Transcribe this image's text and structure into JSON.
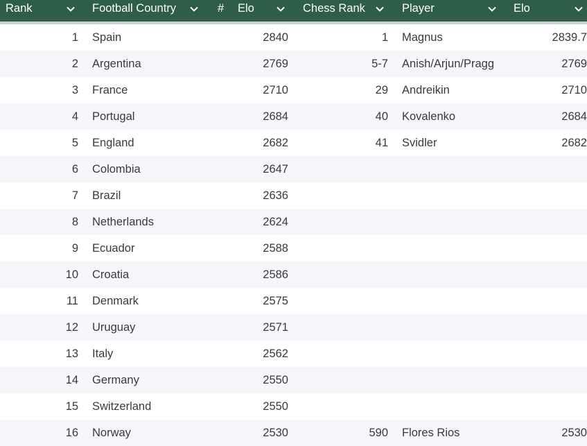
{
  "header": {
    "rank": "Rank",
    "football_country": "Football Country",
    "hash": "#",
    "elo": "Elo",
    "chess_rank": "Chess Rank",
    "player": "Player",
    "player_elo": "Elo"
  },
  "icons": {
    "sort": "chevron-down-icon"
  },
  "colors": {
    "header_bg": "#2e5e4a",
    "header_text": "#ffffff",
    "row_alt": "#f5f7fa"
  },
  "rows": [
    {
      "rank": "1",
      "country": "Spain",
      "elo": "2840",
      "chess_rank": "1",
      "player": "Magnus",
      "player_elo": "2839.7"
    },
    {
      "rank": "2",
      "country": "Argentina",
      "elo": "2769",
      "chess_rank": "5-7",
      "player": "Anish/Arjun/Pragg",
      "player_elo": "2769"
    },
    {
      "rank": "3",
      "country": "France",
      "elo": "2710",
      "chess_rank": "29",
      "player": "Andreikin",
      "player_elo": "2710"
    },
    {
      "rank": "4",
      "country": "Portugal",
      "elo": "2684",
      "chess_rank": "40",
      "player": "Kovalenko",
      "player_elo": "2684"
    },
    {
      "rank": "5",
      "country": "England",
      "elo": "2682",
      "chess_rank": "41",
      "player": "Svidler",
      "player_elo": "2682"
    },
    {
      "rank": "6",
      "country": "Colombia",
      "elo": "2647",
      "chess_rank": "",
      "player": "",
      "player_elo": ""
    },
    {
      "rank": "7",
      "country": "Brazil",
      "elo": "2636",
      "chess_rank": "",
      "player": "",
      "player_elo": ""
    },
    {
      "rank": "8",
      "country": "Netherlands",
      "elo": "2624",
      "chess_rank": "",
      "player": "",
      "player_elo": ""
    },
    {
      "rank": "9",
      "country": "Ecuador",
      "elo": "2588",
      "chess_rank": "",
      "player": "",
      "player_elo": ""
    },
    {
      "rank": "10",
      "country": "Croatia",
      "elo": "2586",
      "chess_rank": "",
      "player": "",
      "player_elo": ""
    },
    {
      "rank": "11",
      "country": "Denmark",
      "elo": "2575",
      "chess_rank": "",
      "player": "",
      "player_elo": ""
    },
    {
      "rank": "12",
      "country": "Uruguay",
      "elo": "2571",
      "chess_rank": "",
      "player": "",
      "player_elo": ""
    },
    {
      "rank": "13",
      "country": "Italy",
      "elo": "2562",
      "chess_rank": "",
      "player": "",
      "player_elo": ""
    },
    {
      "rank": "14",
      "country": "Germany",
      "elo": "2550",
      "chess_rank": "",
      "player": "",
      "player_elo": ""
    },
    {
      "rank": "15",
      "country": "Switzerland",
      "elo": "2550",
      "chess_rank": "",
      "player": "",
      "player_elo": ""
    },
    {
      "rank": "16",
      "country": "Norway",
      "elo": "2530",
      "chess_rank": "590",
      "player": "Flores Rios",
      "player_elo": "2530"
    }
  ]
}
